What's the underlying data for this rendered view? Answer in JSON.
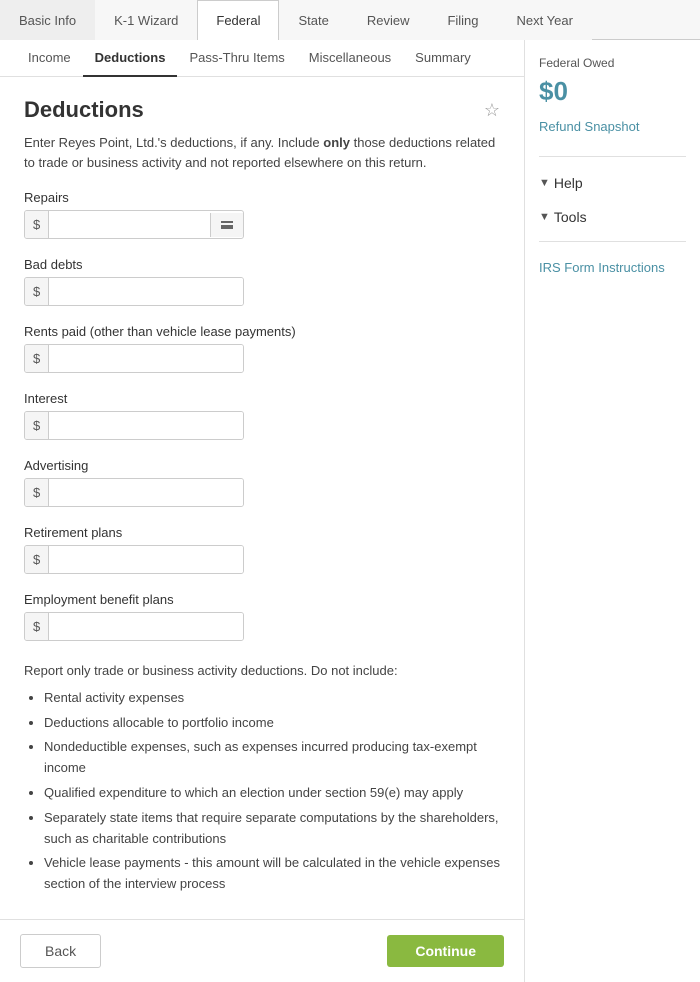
{
  "topTabs": [
    {
      "id": "basic-info",
      "label": "Basic Info",
      "active": false
    },
    {
      "id": "k1-wizard",
      "label": "K-1 Wizard",
      "active": false
    },
    {
      "id": "federal",
      "label": "Federal",
      "active": true
    },
    {
      "id": "state",
      "label": "State",
      "active": false
    },
    {
      "id": "review",
      "label": "Review",
      "active": false
    },
    {
      "id": "filing",
      "label": "Filing",
      "active": false
    },
    {
      "id": "next-year",
      "label": "Next Year",
      "active": false
    }
  ],
  "subTabs": [
    {
      "id": "income",
      "label": "Income",
      "active": false
    },
    {
      "id": "deductions",
      "label": "Deductions",
      "active": true
    },
    {
      "id": "pass-thru",
      "label": "Pass-Thru Items",
      "active": false
    },
    {
      "id": "miscellaneous",
      "label": "Miscellaneous",
      "active": false
    },
    {
      "id": "summary",
      "label": "Summary",
      "active": false
    }
  ],
  "section": {
    "title": "Deductions",
    "description_prefix": "Enter Reyes Point, Ltd.'s deductions, if any. Include ",
    "description_bold": "only",
    "description_suffix": " those deductions related to trade or business activity and not reported elsewhere on this return."
  },
  "fields": [
    {
      "id": "repairs",
      "label": "Repairs",
      "has_list_icon": true
    },
    {
      "id": "bad-debts",
      "label": "Bad debts",
      "has_list_icon": false
    },
    {
      "id": "rents-paid",
      "label": "Rents paid (other than vehicle lease payments)",
      "has_list_icon": false
    },
    {
      "id": "interest",
      "label": "Interest",
      "has_list_icon": false
    },
    {
      "id": "advertising",
      "label": "Advertising",
      "has_list_icon": false
    },
    {
      "id": "retirement-plans",
      "label": "Retirement plans",
      "has_list_icon": false
    },
    {
      "id": "employment-benefit",
      "label": "Employment benefit plans",
      "has_list_icon": false
    }
  ],
  "notes": {
    "intro": "Report only trade or business activity deductions. Do not include:",
    "items": [
      "Rental activity expenses",
      "Deductions allocable to portfolio income",
      "Nondeductible expenses, such as expenses incurred producing tax-exempt income",
      "Qualified expenditure to which an election under section 59(e) may apply",
      "Separately state items that require separate computations by the shareholders, such as charitable contributions",
      "Vehicle lease payments - this amount will be calculated in the vehicle expenses section of the interview process"
    ]
  },
  "buttons": {
    "back": "Back",
    "continue": "Continue"
  },
  "sidebar": {
    "owed_label": "Federal Owed",
    "owed_amount": "$0",
    "refund_snapshot": "Refund Snapshot",
    "help_label": "Help",
    "tools_label": "Tools",
    "irs_form_label": "IRS Form Instructions"
  }
}
